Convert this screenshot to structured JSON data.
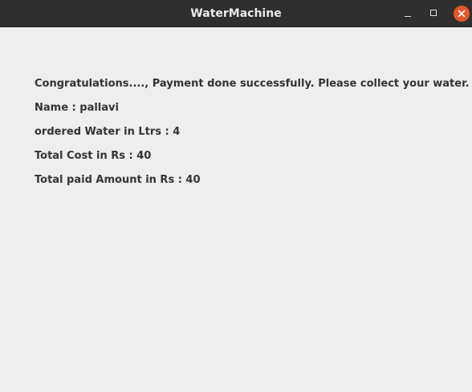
{
  "window": {
    "title": "WaterMachine",
    "minimize_icon": "minimize-icon",
    "maximize_icon": "maximize-icon",
    "close_icon": "close-icon",
    "close_color": "#e9542a"
  },
  "message": {
    "confirmation": "Congratulations....,  Payment done successfully. Please collect your water.",
    "name": "Name : pallavi",
    "ordered_water": "ordered Water in Ltrs : 4",
    "total_cost": "Total Cost in Rs : 40",
    "total_paid": "Total paid Amount in Rs : 40"
  }
}
